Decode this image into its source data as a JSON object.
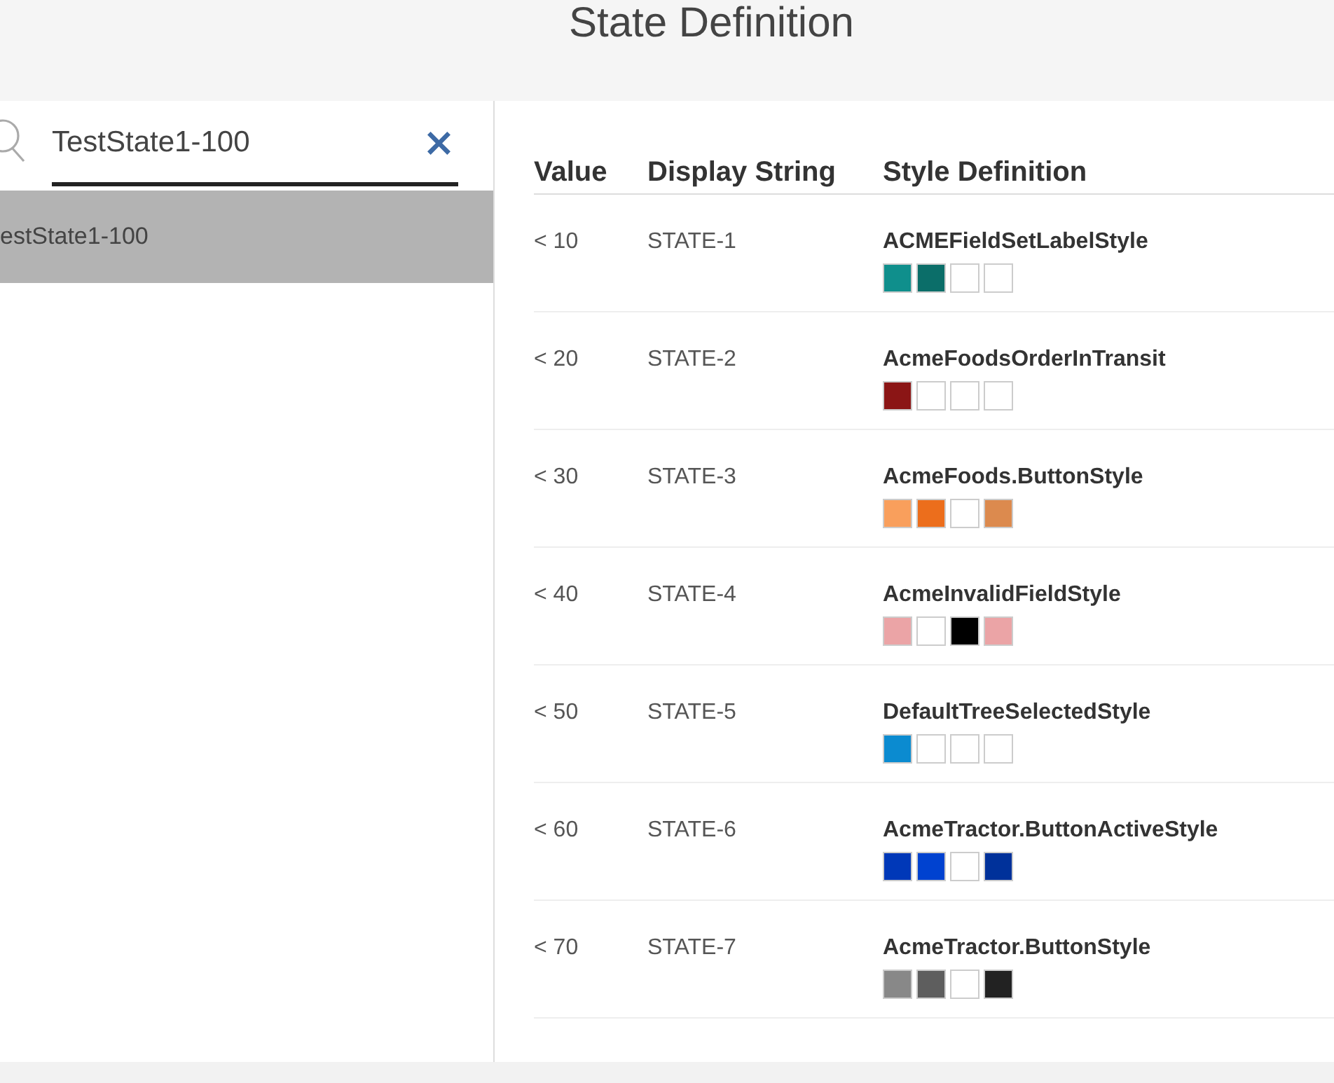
{
  "window": {
    "title": "State Definition"
  },
  "search": {
    "value": "TestState1-100",
    "clear": "×"
  },
  "list": {
    "items": [
      {
        "label": "estState1-100",
        "selected": true
      }
    ]
  },
  "table": {
    "columns": [
      "Value",
      "Display String",
      "Style Definition"
    ],
    "rows": [
      {
        "value": "< 10",
        "display": "STATE-1",
        "style": "ACMEFieldSetLabelStyle",
        "swatches": [
          {
            "color": "#0f8f8c"
          },
          {
            "color": "#0b6e69"
          },
          {
            "color": "#ffffff"
          },
          {
            "color": "#ffffff"
          }
        ]
      },
      {
        "value": "< 20",
        "display": "STATE-2",
        "style": "AcmeFoodsOrderInTransit",
        "swatches": [
          {
            "color": "#8b1515"
          },
          {
            "color": "#ffffff"
          },
          {
            "color": "#ffffff"
          },
          {
            "color": "#ffffff"
          }
        ]
      },
      {
        "value": "< 30",
        "display": "STATE-3",
        "style": "AcmeFoods.ButtonStyle",
        "swatches": [
          {
            "color": "#f99f5c"
          },
          {
            "color": "#ec6e1c"
          },
          {
            "color": "#ffffff"
          },
          {
            "color": "#dc8a4e"
          }
        ]
      },
      {
        "value": "< 40",
        "display": "STATE-4",
        "style": "AcmeInvalidFieldStyle",
        "swatches": [
          {
            "color": "#eba4a6"
          },
          {
            "color": "#ffffff"
          },
          {
            "color": "#000000"
          },
          {
            "color": "#eba4a6"
          }
        ]
      },
      {
        "value": "< 50",
        "display": "STATE-5",
        "style": "DefaultTreeSelectedStyle",
        "swatches": [
          {
            "color": "#0b8bd0"
          },
          {
            "color": "#ffffff"
          },
          {
            "color": "#ffffff"
          },
          {
            "color": "#ffffff"
          }
        ]
      },
      {
        "value": "< 60",
        "display": "STATE-6",
        "style": "AcmeTractor.ButtonActiveStyle",
        "swatches": [
          {
            "color": "#0038b8"
          },
          {
            "color": "#0042d0"
          },
          {
            "color": "#ffffff"
          },
          {
            "color": "#00319a"
          }
        ]
      },
      {
        "value": "< 70",
        "display": "STATE-7",
        "style": "AcmeTractor.ButtonStyle",
        "swatches": [
          {
            "color": "#888888"
          },
          {
            "color": "#5e5e5e"
          },
          {
            "color": "#ffffff"
          },
          {
            "color": "#222222"
          }
        ]
      }
    ]
  }
}
